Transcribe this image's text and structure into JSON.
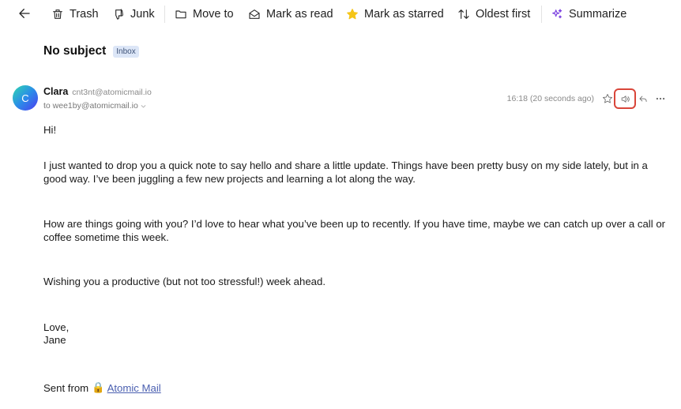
{
  "toolbar": {
    "trash_label": "Trash",
    "junk_label": "Junk",
    "move_label": "Move to",
    "mark_read_label": "Mark as read",
    "mark_starred_label": "Mark as starred",
    "sort_label": "Oldest first",
    "summarize_label": "Summarize"
  },
  "message": {
    "subject": "No subject",
    "folder_badge": "Inbox",
    "avatar_initial": "C",
    "sender_name": "Clara",
    "sender_email": "cnt3nt@atomicmail.io",
    "recipient": "to wee1by@atomicmail.io",
    "timestamp": "16:18 (20 seconds ago)",
    "body": {
      "greeting": "Hi!",
      "p1": "I just wanted to drop you a quick note to say hello and share a little update. Things have been pretty busy on my side lately, but in a good way. I’ve been juggling a few new projects and learning a lot along the way.",
      "p2": "How are things going with you? I’d love to hear what you’ve been up to recently. If you have time, maybe we can catch up over a call or coffee sometime this week.",
      "p3": "Wishing you a productive (but not too stressful!) week ahead.",
      "signoff": "Love,",
      "signature": "Jane",
      "sent_from_prefix": "Sent from",
      "lock_glyph": "🔒",
      "sent_from_link": "Atomic Mail"
    }
  },
  "colors": {
    "accent_highlight": "#d9463a",
    "star_toolbar": "#f5c518",
    "summarize_icon": "#7a3fe0",
    "badge_bg": "#dce6f7",
    "link": "#4a5fb0"
  }
}
